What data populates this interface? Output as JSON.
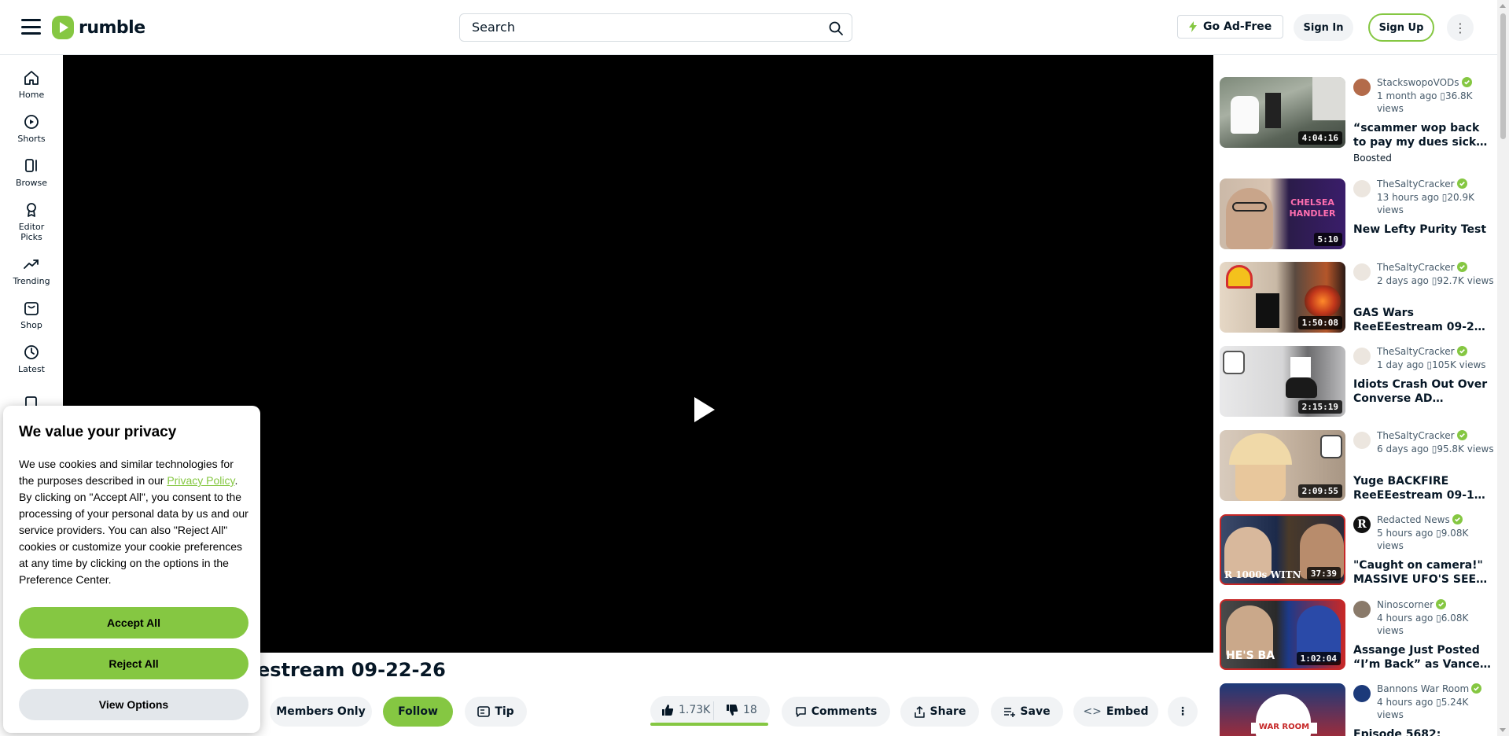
{
  "header": {
    "logo_text": "rumble",
    "search_placeholder": "Search",
    "go_ad_free": "Go Ad-Free",
    "sign_in": "Sign In",
    "sign_up": "Sign Up"
  },
  "nav": [
    {
      "label": "Home",
      "icon": "home-icon"
    },
    {
      "label": "Shorts",
      "icon": "shorts-icon"
    },
    {
      "label": "Browse",
      "icon": "browse-icon"
    },
    {
      "label": "Editor Picks",
      "icon": "award-icon"
    },
    {
      "label": "Trending",
      "icon": "trending-icon"
    },
    {
      "label": "Shop",
      "icon": "shop-icon"
    },
    {
      "label": "Latest",
      "icon": "clock-icon"
    }
  ],
  "video": {
    "title_visible": "estream 09-22-26",
    "members_only": "Members Only",
    "follow": "Follow",
    "tip": "Tip",
    "likes": "1.73K",
    "dislikes": "18",
    "like_ratio": 0.99,
    "comments": "Comments",
    "share": "Share",
    "save": "Save",
    "embed": "Embed"
  },
  "cookie": {
    "title": "We value your privacy",
    "text_before_link": "We use cookies and similar technologies for the purposes described in our ",
    "link": "Privacy Policy",
    "text_after_link": ". By clicking on \"Accept All\", you consent to the processing of your personal data by us and our service providers. You can also \"Reject All\" cookies or customize your cookie preferences at any time by clicking on the options in the Preference Center.",
    "accept": "Accept All",
    "reject": "Reject All",
    "options": "View Options"
  },
  "related": [
    {
      "channel": "StackswopoVODs",
      "meta": "1 month ago ▯36.8K views",
      "title": "“scammer wop back to pay my dues sick…",
      "duration": "4:04:16",
      "boosted": "Boosted"
    },
    {
      "channel": "TheSaltyCracker",
      "meta": "13 hours ago ▯20.9K views",
      "title": "New Lefty Purity Test",
      "duration": "5:10"
    },
    {
      "channel": "TheSaltyCracker",
      "meta": "2 days ago ▯92.7K views",
      "title": "GAS Wars ReeEEestream 09-2…",
      "duration": "1:50:08"
    },
    {
      "channel": "TheSaltyCracker",
      "meta": "1 day ago ▯105K views",
      "title": "Idiots Crash Out Over Converse AD…",
      "duration": "2:15:19"
    },
    {
      "channel": "TheSaltyCracker",
      "meta": "6 days ago ▯95.8K views",
      "title": "Yuge BACKFIRE ReeEEestream 09-1…",
      "duration": "2:09:55"
    },
    {
      "channel": "Redacted News",
      "meta": "5 hours ago ▯9.08K views",
      "title": "\"Caught on camera!\" MASSIVE UFO'S SEE…",
      "duration": "37:39"
    },
    {
      "channel": "Ninoscorner",
      "meta": "4 hours ago ▯6.08K views",
      "title": "Assange Just Posted “I’m Back” as Vance…",
      "duration": "1:02:04"
    },
    {
      "channel": "Bannons War Room",
      "meta": "4 hours ago ▯5.24K views",
      "title": "Episode 5682:",
      "duration": ""
    }
  ],
  "colors": {
    "accent": "#85c742",
    "text": "#061726",
    "muted": "#475b6b",
    "pill": "#f1f3f5"
  }
}
